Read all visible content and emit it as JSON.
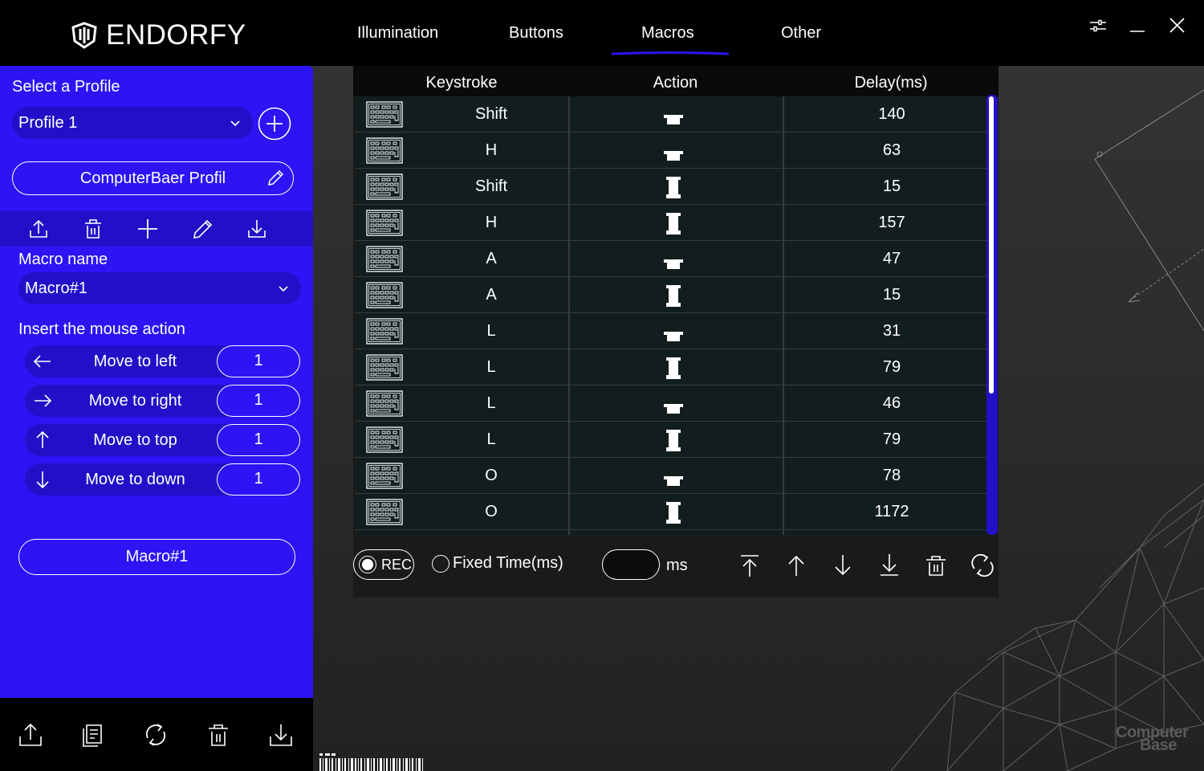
{
  "app": {
    "brand": "ENDORFY"
  },
  "tabs": [
    {
      "label": "Illumination"
    },
    {
      "label": "Buttons"
    },
    {
      "label": "Macros",
      "active": true
    },
    {
      "label": "Other"
    }
  ],
  "colors": {
    "accent": "#2c14f4",
    "accent_dark": "#2210c8",
    "background": "#2a2a2a",
    "row": "#121e1e"
  },
  "sidebar": {
    "select_profile_label": "Select a Profile",
    "profile_selected": "Profile 1",
    "profile_name_button": "ComputerBaer Profil",
    "macro_name_label": "Macro name",
    "macro_selected": "Macro#1",
    "insert_mouse_label": "Insert the mouse action",
    "mouse_actions": [
      {
        "label": "Move to left",
        "value": "1",
        "icon": "arrow-left-icon"
      },
      {
        "label": "Move to right",
        "value": "1",
        "icon": "arrow-right-icon"
      },
      {
        "label": "Move to top",
        "value": "1",
        "icon": "arrow-up-icon"
      },
      {
        "label": "Move to down",
        "value": "1",
        "icon": "arrow-down-icon"
      }
    ],
    "macro_button": "Macro#1"
  },
  "table": {
    "headers": {
      "keystroke": "Keystroke",
      "action": "Action",
      "delay": "Delay(ms)"
    },
    "rows": [
      {
        "key": "Shift",
        "action": "release",
        "delay": "140"
      },
      {
        "key": "H",
        "action": "release",
        "delay": "63"
      },
      {
        "key": "Shift",
        "action": "press",
        "delay": "15"
      },
      {
        "key": "H",
        "action": "press",
        "delay": "157"
      },
      {
        "key": "A",
        "action": "release",
        "delay": "47"
      },
      {
        "key": "A",
        "action": "press",
        "delay": "15"
      },
      {
        "key": "L",
        "action": "release",
        "delay": "31"
      },
      {
        "key": "L",
        "action": "press",
        "delay": "79"
      },
      {
        "key": "L",
        "action": "release",
        "delay": "46"
      },
      {
        "key": "L",
        "action": "press",
        "delay": "79"
      },
      {
        "key": "O",
        "action": "release",
        "delay": "78"
      },
      {
        "key": "O",
        "action": "press",
        "delay": "1172"
      }
    ]
  },
  "footer": {
    "rec_label": "REC",
    "fixed_time_label": "Fixed Time(ms)",
    "ms_value": "",
    "ms_label": "ms"
  },
  "watermark": {
    "line1": "Computer",
    "line2": "Base"
  }
}
